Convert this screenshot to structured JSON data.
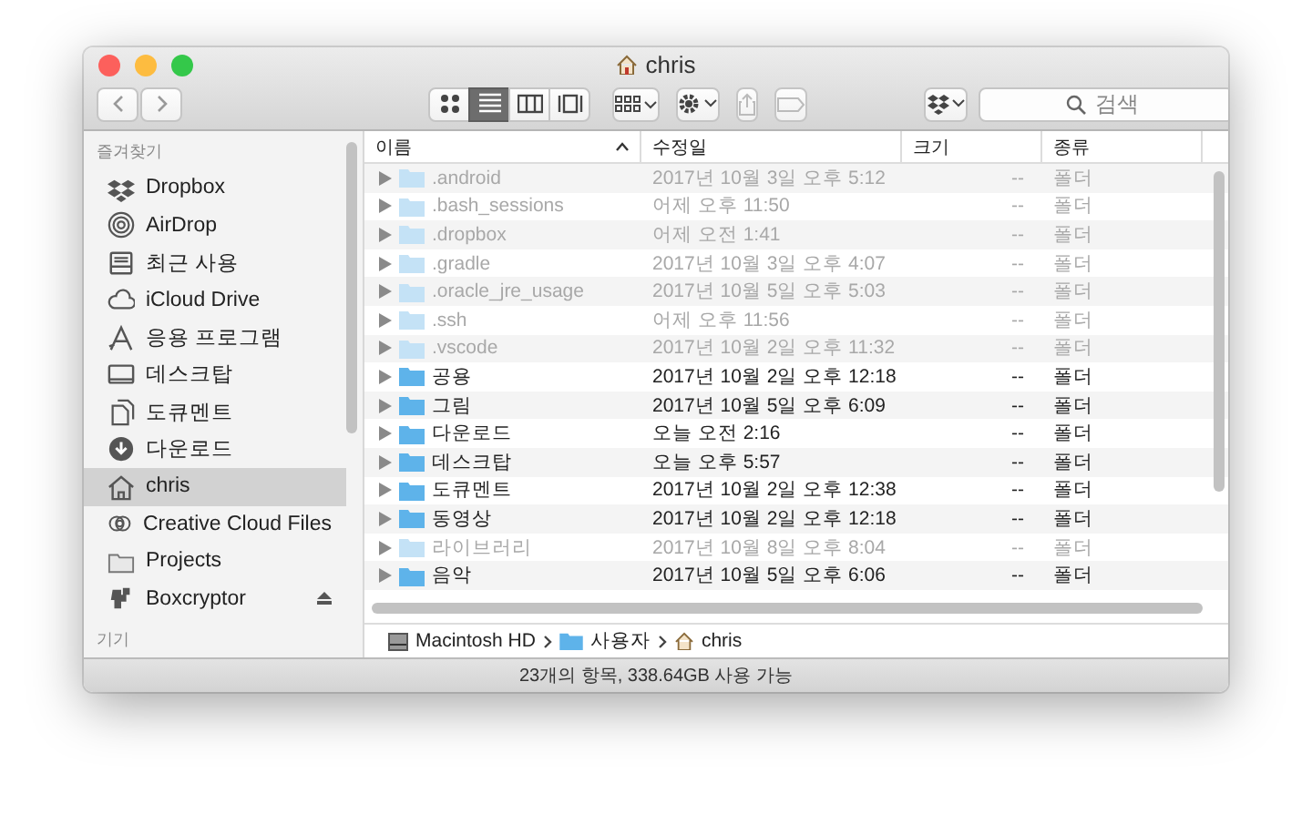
{
  "window": {
    "title": "chris"
  },
  "toolbar": {
    "view_modes": [
      {
        "selected": false
      },
      {
        "selected": true
      },
      {
        "selected": false
      },
      {
        "selected": false
      }
    ],
    "search": {
      "placeholder": "검색"
    }
  },
  "sidebar": {
    "sections": [
      {
        "label": "즐겨찾기",
        "items": [
          {
            "label": "Dropbox",
            "selected": false
          },
          {
            "label": "AirDrop",
            "selected": false
          },
          {
            "label": "최근 사용",
            "selected": false
          },
          {
            "label": "iCloud Drive",
            "selected": false
          },
          {
            "label": "응용 프로그램",
            "selected": false
          },
          {
            "label": "데스크탑",
            "selected": false
          },
          {
            "label": "도큐멘트",
            "selected": false
          },
          {
            "label": "다운로드",
            "selected": false
          },
          {
            "label": "chris",
            "selected": true
          },
          {
            "label": "Creative Cloud Files",
            "selected": false
          },
          {
            "label": "Projects",
            "selected": false
          },
          {
            "label": "Boxcryptor",
            "selected": false,
            "ejectable": true
          }
        ]
      },
      {
        "label": "기기"
      }
    ]
  },
  "table": {
    "columns": [
      {
        "label": "이름",
        "sorted": true
      },
      {
        "label": "수정일",
        "sorted": false
      },
      {
        "label": "크기",
        "sorted": false
      },
      {
        "label": "종류",
        "sorted": false
      }
    ],
    "rows": [
      {
        "name": ".android",
        "modified": "2017년 10월 3일 오후 5:12",
        "size": "--",
        "kind": "폴더",
        "hidden": true
      },
      {
        "name": ".bash_sessions",
        "modified": "어제 오후 11:50",
        "size": "--",
        "kind": "폴더",
        "hidden": true
      },
      {
        "name": ".dropbox",
        "modified": "어제 오전 1:41",
        "size": "--",
        "kind": "폴더",
        "hidden": true
      },
      {
        "name": ".gradle",
        "modified": "2017년 10월 3일 오후 4:07",
        "size": "--",
        "kind": "폴더",
        "hidden": true
      },
      {
        "name": ".oracle_jre_usage",
        "modified": "2017년 10월 5일 오후 5:03",
        "size": "--",
        "kind": "폴더",
        "hidden": true
      },
      {
        "name": ".ssh",
        "modified": "어제 오후 11:56",
        "size": "--",
        "kind": "폴더",
        "hidden": true
      },
      {
        "name": ".vscode",
        "modified": "2017년 10월 2일 오후 11:32",
        "size": "--",
        "kind": "폴더",
        "hidden": true
      },
      {
        "name": "공용",
        "modified": "2017년 10월 2일 오후 12:18",
        "size": "--",
        "kind": "폴더",
        "hidden": false
      },
      {
        "name": "그림",
        "modified": "2017년 10월 5일 오후 6:09",
        "size": "--",
        "kind": "폴더",
        "hidden": false
      },
      {
        "name": "다운로드",
        "modified": "오늘 오전 2:16",
        "size": "--",
        "kind": "폴더",
        "hidden": false
      },
      {
        "name": "데스크탑",
        "modified": "오늘 오후 5:57",
        "size": "--",
        "kind": "폴더",
        "hidden": false
      },
      {
        "name": "도큐멘트",
        "modified": "2017년 10월 2일 오후 12:38",
        "size": "--",
        "kind": "폴더",
        "hidden": false
      },
      {
        "name": "동영상",
        "modified": "2017년 10월 2일 오후 12:18",
        "size": "--",
        "kind": "폴더",
        "hidden": false
      },
      {
        "name": "라이브러리",
        "modified": "2017년 10월 8일 오후 8:04",
        "size": "--",
        "kind": "폴더",
        "hidden": true
      },
      {
        "name": "음악",
        "modified": "2017년 10월 5일 오후 6:06",
        "size": "--",
        "kind": "폴더",
        "hidden": false
      }
    ]
  },
  "path_bar": [
    {
      "label": "Macintosh HD"
    },
    {
      "label": "사용자"
    },
    {
      "label": "chris"
    }
  ],
  "status_bar": "23개의 항목, 338.64GB 사용 가능"
}
